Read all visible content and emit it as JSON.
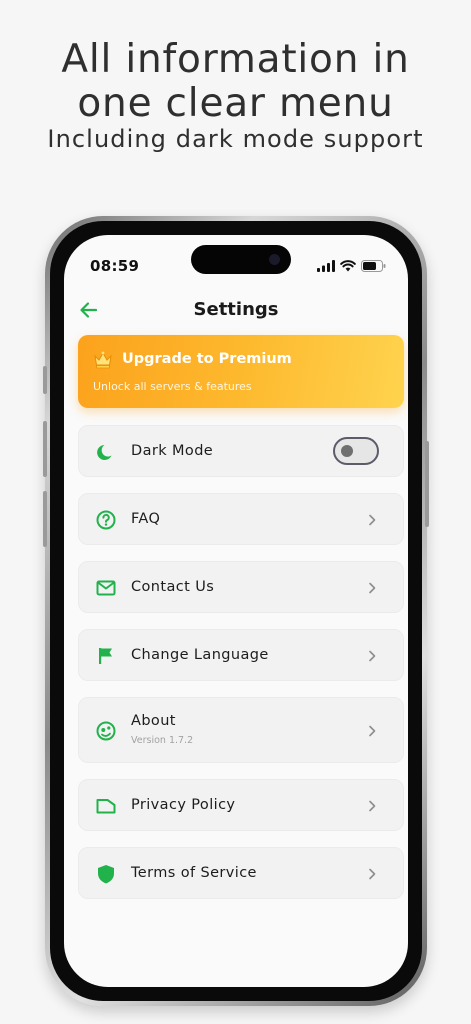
{
  "headline": {
    "line1": "All information in",
    "line2": "one clear menu",
    "subtitle": "Including dark mode support"
  },
  "status_bar": {
    "time": "08:59"
  },
  "header": {
    "title": "Settings",
    "back_icon": "arrow-left-icon"
  },
  "premium": {
    "title": "Upgrade to Premium",
    "subtitle": "Unlock all servers & features",
    "icon": "crown-icon"
  },
  "settings": {
    "dark_mode": {
      "label": "Dark Mode",
      "icon": "moon-icon",
      "enabled": false
    },
    "faq": {
      "label": "FAQ",
      "icon": "question-circle-icon"
    },
    "contact": {
      "label": "Contact Us",
      "icon": "envelope-icon"
    },
    "language": {
      "label": "Change Language",
      "icon": "flag-icon"
    },
    "about": {
      "label": "About",
      "sublabel": "Version 1.7.2",
      "icon": "face-icon"
    },
    "privacy": {
      "label": "Privacy Policy",
      "icon": "document-icon"
    },
    "terms": {
      "label": "Terms of Service",
      "icon": "shield-icon"
    }
  },
  "colors": {
    "accent": "#22b24c",
    "premium_start": "#fca21c",
    "premium_end": "#ffd34e",
    "row_background": "#f2f2f2"
  }
}
